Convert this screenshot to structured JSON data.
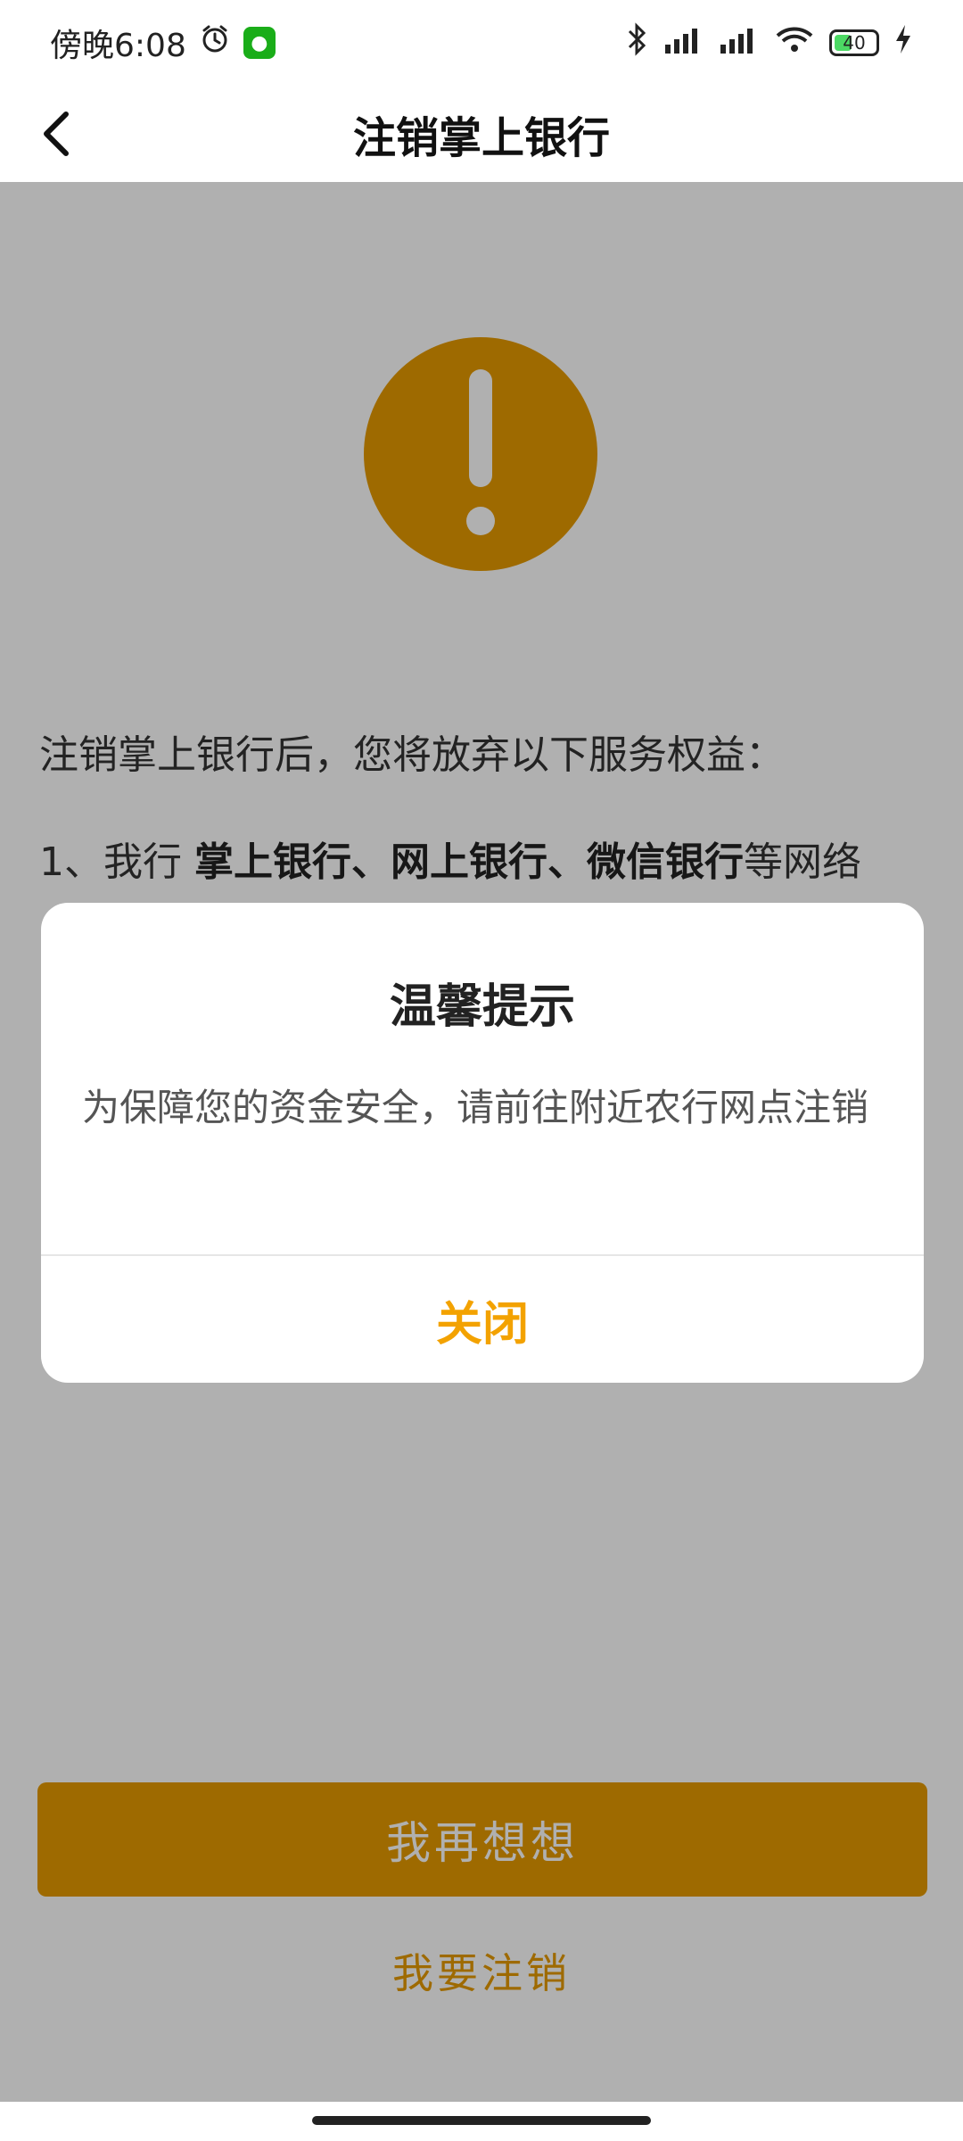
{
  "status_bar": {
    "time": "傍晚6:08",
    "battery": "40"
  },
  "nav": {
    "title": "注销掌上银行"
  },
  "content": {
    "intro": "注销掌上银行后，您将放弃以下服务权益：",
    "item1_prefix": "1、我行 ",
    "item1_bold": "掌上银行、网上银行、微信银行",
    "item1_suffix": "等网络"
  },
  "buttons": {
    "primary": "我再想想",
    "secondary": "我要注销"
  },
  "dialog": {
    "title": "温馨提示",
    "message": "为保障您的资金安全，请前往附近农行网点注销",
    "close": "关闭"
  },
  "colors": {
    "accent": "#e59a00",
    "dialog_close": "#f3a200"
  }
}
